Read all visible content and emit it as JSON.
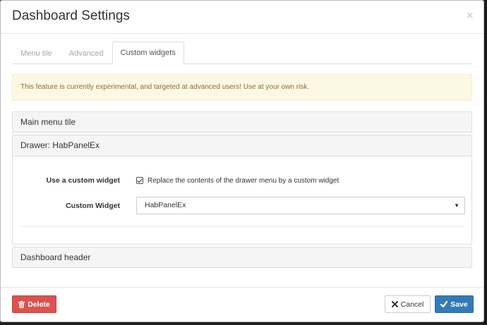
{
  "modal": {
    "title": "Dashboard Settings",
    "close_symbol": "×"
  },
  "tabs": [
    {
      "label": "Menu tile",
      "active": false
    },
    {
      "label": "Advanced",
      "active": false
    },
    {
      "label": "Custom widgets",
      "active": true
    }
  ],
  "alert": {
    "text": "This feature is currently experimental, and targeted at advanced users! Use at your own risk."
  },
  "panels": {
    "main_menu_tile": "Main menu tile",
    "drawer": "Drawer: HabPanelEx",
    "dashboard_header": "Dashboard header"
  },
  "drawer_form": {
    "use_custom_widget_label": "Use a custom widget",
    "use_custom_widget_checked": true,
    "use_custom_widget_text": "Replace the contents of the drawer menu by a custom widget",
    "custom_widget_label": "Custom Widget",
    "custom_widget_value": "HabPanelEx",
    "caret": "▼"
  },
  "footer": {
    "delete_label": "Delete",
    "cancel_label": "Cancel",
    "save_label": "Save"
  },
  "colors": {
    "delete": "#d9534f",
    "save": "#337ab7",
    "alert_bg": "#fcf8e3",
    "alert_text": "#8a6d3b"
  },
  "icons": {
    "delete": "trash-icon",
    "cancel": "close-icon",
    "save": "check-icon"
  }
}
